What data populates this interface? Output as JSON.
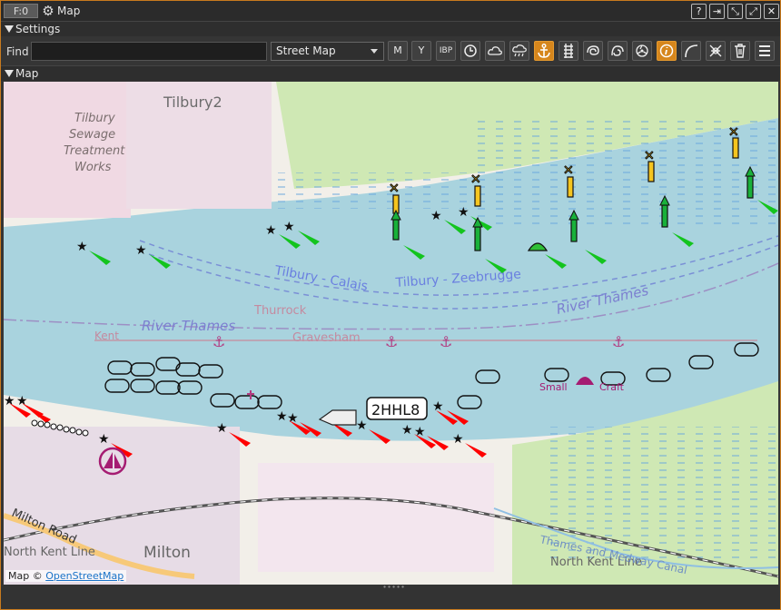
{
  "titlebar": {
    "badge": "F:0",
    "title": "Map"
  },
  "sections": {
    "settings": "Settings",
    "map": "Map"
  },
  "toolbar": {
    "find_label": "Find",
    "find_value": "",
    "map_style": "Street Map",
    "buttons": [
      "M",
      "Y",
      "IBP",
      "clock",
      "cloud",
      "rain",
      "anchor",
      "rail",
      "swirl",
      "steer",
      "scatter",
      "info",
      "arc",
      "shear",
      "trash",
      "menu"
    ]
  },
  "map": {
    "labels": {
      "tilbury2": "Tilbury2",
      "tilbury": "Tilbury",
      "sewage": "Sewage",
      "treatment": "Treatment",
      "works": "Works",
      "tilbury_calais": "Tilbury - Calais",
      "tilbury_zeebrugge": "Tilbury - Zeebrugge",
      "river_thames_1": "River Thames",
      "river_thames_2": "River Thames",
      "thurrock": "Thurrock",
      "kent": "Kent",
      "gravesham": "Gravesham",
      "small": "Small",
      "craft": "Craft",
      "callsign": "2HHL8",
      "milton_road": "Milton Road",
      "milton": "Milton",
      "north_kent_line_1": "North Kent Line",
      "north_kent_line_2": "North Kent Line",
      "medway_canal": "Thames and Medway Canal"
    },
    "attribution_prefix": "Map ©",
    "attribution_link": "OpenStreetMap"
  },
  "colors": {
    "accent": "#d6861c",
    "water": "#a9d3de",
    "land": "#f2efe9"
  }
}
